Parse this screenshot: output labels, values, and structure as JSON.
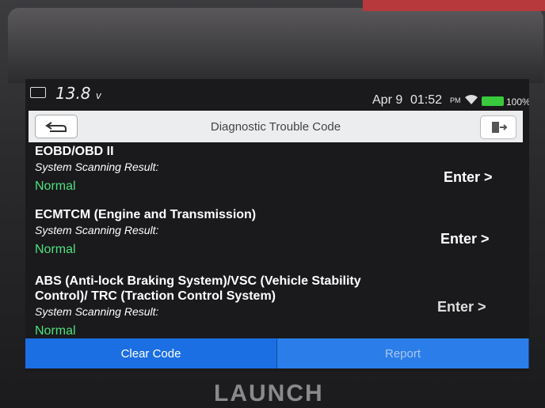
{
  "status": {
    "voltage": "13.8",
    "voltage_unit": "v",
    "date": "Apr 9",
    "time": "01:52",
    "ampm": "PM",
    "battery": "100%"
  },
  "header": {
    "title": "Diagnostic Trouble Code"
  },
  "items": [
    {
      "title": "EOBD/OBD II",
      "label": "System Scanning Result:",
      "status": "Normal",
      "action": "Enter >"
    },
    {
      "title": "ECMTCM (Engine and Transmission)",
      "label": "System Scanning Result:",
      "status": "Normal",
      "action": "Enter >"
    },
    {
      "title": "ABS (Anti-lock Braking System)/VSC (Vehicle Stability Control)/ TRC (Traction Control System)",
      "label": "System Scanning Result:",
      "status": "Normal",
      "action": "Enter >"
    }
  ],
  "footer": {
    "clear_label": "Clear Code",
    "report_label": "Report"
  },
  "brand": {
    "logo_text": "LAUNCH"
  },
  "colors": {
    "normal": "#4fe07e",
    "button": "#1c6fe3"
  }
}
